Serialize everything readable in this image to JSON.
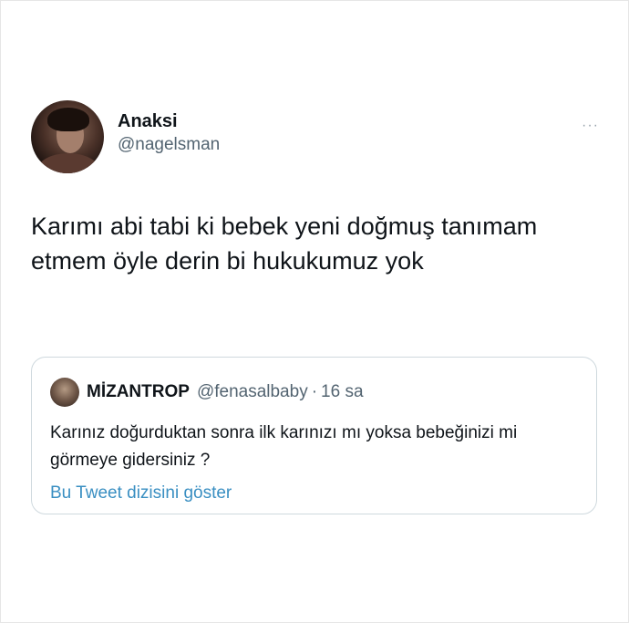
{
  "tweet": {
    "display_name": "Anaksi",
    "handle": "@nagelsman",
    "more_icon": "more-dots-icon",
    "more_glyph": "···",
    "text": "Karımı abi tabi ki bebek yeni doğmuş tanımam etmem öyle derin bi hukukumuz yok"
  },
  "quote": {
    "display_name": "MİZANTROP",
    "handle": "@fenasalbaby",
    "separator": "·",
    "time": "16 sa",
    "text": "Karınız doğurduktan sonra ilk karınızı mı yoksa bebeğinizi mi görmeye gidersiniz ?",
    "show_thread_label": "Bu Tweet dizisini göster"
  },
  "colors": {
    "text_primary": "#0f1419",
    "text_secondary": "#536471",
    "link": "#3a8fc2",
    "border": "#cfd9de"
  }
}
